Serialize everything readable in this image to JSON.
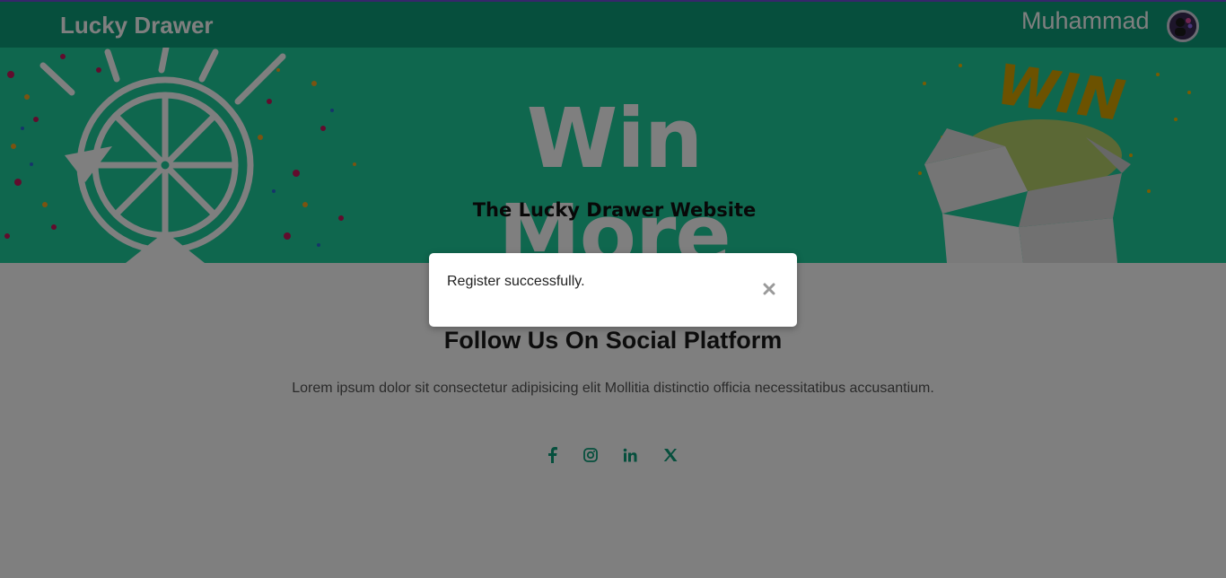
{
  "navbar": {
    "brand": "Lucky Drawer",
    "user_name": "Muhammad",
    "avatar_icon": "avatar-icon"
  },
  "banner": {
    "title": "Win More",
    "subtitle": "The Lucky Drawer Website",
    "prize_word": "WIN"
  },
  "follow": {
    "title": "Follow Us On Social Platform",
    "text": "Lorem ipsum dolor sit consectetur adipisicing elit Mollitia distinctio officia necessitatibus accusantium.",
    "icons": [
      "facebook-icon",
      "instagram-icon",
      "linkedin-icon",
      "x-icon"
    ]
  },
  "modal": {
    "message": "Register successfully.",
    "close_icon": "close-icon"
  },
  "colors": {
    "primary": "#0d9e7a",
    "banner": "#1fcf9d",
    "overlay": "rgba(0,0,0,0.5)"
  }
}
